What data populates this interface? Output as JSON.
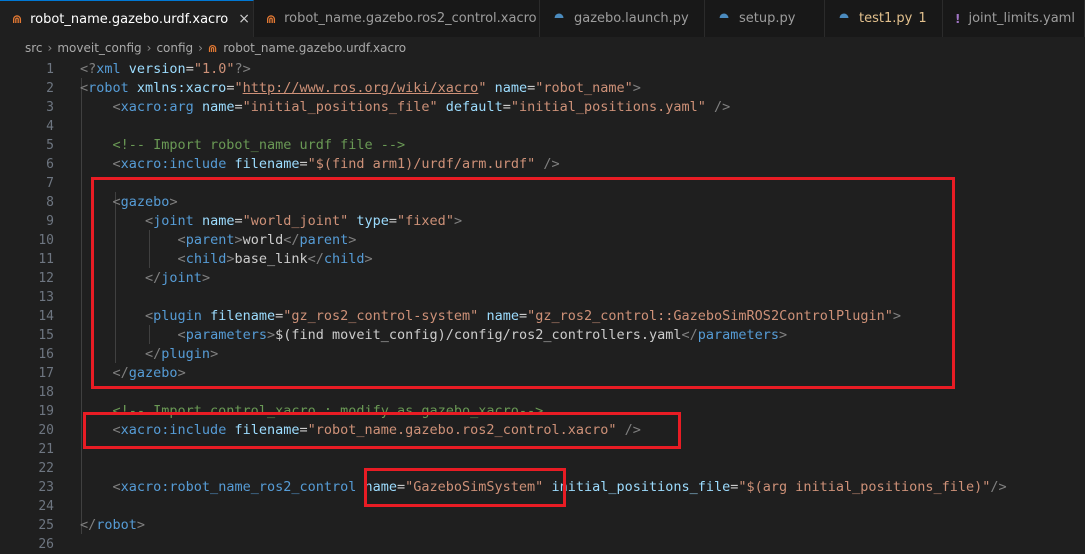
{
  "tabs": [
    {
      "label": "robot_name.gazebo.urdf.xacro",
      "icon": "rss-icon",
      "active": true,
      "close": "×"
    },
    {
      "label": "robot_name.gazebo.ros2_control.xacro",
      "icon": "rss-icon",
      "active": false
    },
    {
      "label": "gazebo.launch.py",
      "icon": "python-icon",
      "active": false
    },
    {
      "label": "setup.py",
      "icon": "python-icon",
      "active": false
    },
    {
      "label": "test1.py",
      "icon": "python-icon",
      "active": false,
      "badge": "1"
    },
    {
      "label": "joint_limits.yaml",
      "icon": "yaml-icon",
      "active": false
    }
  ],
  "breadcrumb": [
    "src",
    "moveit_config",
    "config",
    "robot_name.gazebo.urdf.xacro"
  ],
  "code": {
    "line1": [
      [
        "<?",
        "b"
      ],
      [
        "xml",
        "t"
      ],
      [
        " version",
        "a"
      ],
      [
        "=",
        "p"
      ],
      [
        "\"1.0\"",
        "s"
      ],
      [
        "?>",
        "b"
      ]
    ],
    "line2": [
      [
        "<",
        "b"
      ],
      [
        "robot",
        "t"
      ],
      [
        " xmlns:xacro",
        "a"
      ],
      [
        "=",
        "p"
      ],
      [
        "\"",
        "s"
      ],
      [
        "http://www.ros.org/wiki/xacro",
        "u"
      ],
      [
        "\"",
        "s"
      ],
      [
        " name",
        "a"
      ],
      [
        "=",
        "p"
      ],
      [
        "\"robot_name\"",
        "s"
      ],
      [
        ">",
        "b"
      ]
    ],
    "line3": [
      [
        "    ",
        "p"
      ],
      [
        "<",
        "b"
      ],
      [
        "xacro:arg",
        "t"
      ],
      [
        " name",
        "a"
      ],
      [
        "=",
        "p"
      ],
      [
        "\"initial_positions_file\"",
        "s"
      ],
      [
        " default",
        "a"
      ],
      [
        "=",
        "p"
      ],
      [
        "\"initial_positions.yaml\"",
        "s"
      ],
      [
        " />",
        "b"
      ]
    ],
    "line4": [],
    "line5": [
      [
        "    ",
        "p"
      ],
      [
        "<!-- Import robot_name urdf file -->",
        "c"
      ]
    ],
    "line6": [
      [
        "    ",
        "p"
      ],
      [
        "<",
        "b"
      ],
      [
        "xacro:include",
        "t"
      ],
      [
        " filename",
        "a"
      ],
      [
        "=",
        "p"
      ],
      [
        "\"$(find arm1)/urdf/arm.urdf\"",
        "s"
      ],
      [
        " />",
        "b"
      ]
    ],
    "line7": [],
    "line8": [
      [
        "    ",
        "p"
      ],
      [
        "<",
        "b"
      ],
      [
        "gazebo",
        "t"
      ],
      [
        ">",
        "b"
      ]
    ],
    "line9": [
      [
        "        ",
        "p"
      ],
      [
        "<",
        "b"
      ],
      [
        "joint",
        "t"
      ],
      [
        " name",
        "a"
      ],
      [
        "=",
        "p"
      ],
      [
        "\"world_joint\"",
        "s"
      ],
      [
        " type",
        "a"
      ],
      [
        "=",
        "p"
      ],
      [
        "\"fixed\"",
        "s"
      ],
      [
        ">",
        "b"
      ]
    ],
    "line10": [
      [
        "            ",
        "p"
      ],
      [
        "<",
        "b"
      ],
      [
        "parent",
        "t"
      ],
      [
        ">",
        "b"
      ],
      [
        "world",
        "p"
      ],
      [
        "</",
        "b"
      ],
      [
        "parent",
        "t"
      ],
      [
        ">",
        "b"
      ]
    ],
    "line11": [
      [
        "            ",
        "p"
      ],
      [
        "<",
        "b"
      ],
      [
        "child",
        "t"
      ],
      [
        ">",
        "b"
      ],
      [
        "base_link",
        "p"
      ],
      [
        "</",
        "b"
      ],
      [
        "child",
        "t"
      ],
      [
        ">",
        "b"
      ]
    ],
    "line12": [
      [
        "        ",
        "p"
      ],
      [
        "</",
        "b"
      ],
      [
        "joint",
        "t"
      ],
      [
        ">",
        "b"
      ]
    ],
    "line13": [],
    "line14": [
      [
        "        ",
        "p"
      ],
      [
        "<",
        "b"
      ],
      [
        "plugin",
        "t"
      ],
      [
        " filename",
        "a"
      ],
      [
        "=",
        "p"
      ],
      [
        "\"gz_ros2_control-system\"",
        "s"
      ],
      [
        " name",
        "a"
      ],
      [
        "=",
        "p"
      ],
      [
        "\"gz_ros2_control::GazeboSimROS2ControlPlugin\"",
        "s"
      ],
      [
        ">",
        "b"
      ]
    ],
    "line15": [
      [
        "            ",
        "p"
      ],
      [
        "<",
        "b"
      ],
      [
        "parameters",
        "t"
      ],
      [
        ">",
        "b"
      ],
      [
        "$(find moveit_config)/config/ros2_controllers.yaml",
        "p"
      ],
      [
        "</",
        "b"
      ],
      [
        "parameters",
        "t"
      ],
      [
        ">",
        "b"
      ]
    ],
    "line16": [
      [
        "        ",
        "p"
      ],
      [
        "</",
        "b"
      ],
      [
        "plugin",
        "t"
      ],
      [
        ">",
        "b"
      ]
    ],
    "line17": [
      [
        "    ",
        "p"
      ],
      [
        "</",
        "b"
      ],
      [
        "gazebo",
        "t"
      ],
      [
        ">",
        "b"
      ]
    ],
    "line18": [],
    "line19": [
      [
        "    ",
        "p"
      ],
      [
        "<!-- Import control_xacro : modify as gazebo_xacro-->",
        "c"
      ]
    ],
    "line20": [
      [
        "    ",
        "p"
      ],
      [
        "<",
        "b"
      ],
      [
        "xacro:include",
        "t"
      ],
      [
        " filename",
        "a"
      ],
      [
        "=",
        "p"
      ],
      [
        "\"robot_name.gazebo.ros2_control.xacro\"",
        "s"
      ],
      [
        " />",
        "b"
      ]
    ],
    "line21": [],
    "line22": [],
    "line23": [
      [
        "    ",
        "p"
      ],
      [
        "<",
        "b"
      ],
      [
        "xacro:robot_name_ros2_control",
        "t"
      ],
      [
        " name",
        "a"
      ],
      [
        "=",
        "p"
      ],
      [
        "\"GazeboSimSystem\"",
        "s"
      ],
      [
        " initial_positions_file",
        "a"
      ],
      [
        "=",
        "p"
      ],
      [
        "\"$(arg initial_positions_file)\"",
        "s"
      ],
      [
        "/>",
        "b"
      ]
    ],
    "line24": [],
    "line25": [
      [
        "</",
        "b"
      ],
      [
        "robot",
        "t"
      ],
      [
        ">",
        "b"
      ]
    ],
    "line26": []
  }
}
